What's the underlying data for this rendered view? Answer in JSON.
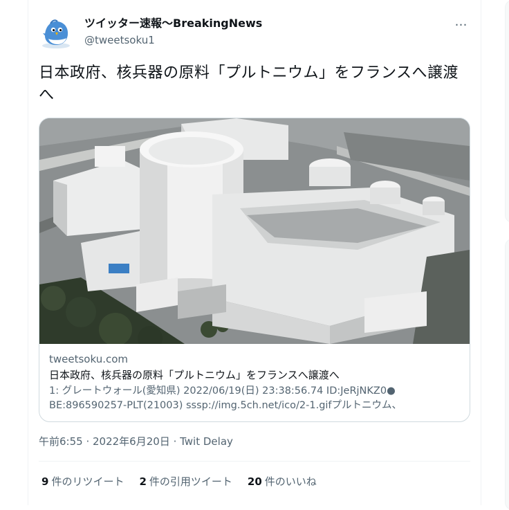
{
  "author": {
    "display_name": "ツイッター速報〜BreakingNews",
    "handle": "@tweetsoku1",
    "avatar_icon": "bird-avatar-icon"
  },
  "more_icon": "…",
  "tweet": {
    "text": "日本政府、核兵器の原料「プルトニウム」をフランスへ譲渡へ"
  },
  "card": {
    "domain": "tweetsoku.com",
    "title": "日本政府、核兵器の原料「プルトニウム」をフランスへ譲渡へ",
    "description_line1": "1: グレートウォール(愛知県) 2022/06/19(日) 23:38:56.74 ID:JeRjNKZ0●",
    "description_line2": "BE:896590257-PLT(21003) sssp://img.5ch.net/ico/2-1.gifプルトニウム、"
  },
  "meta": {
    "timestamp": "午前6:55 · 2022年6月20日",
    "separator": " · ",
    "source": "Twit Delay"
  },
  "stats": {
    "retweets_count": "9",
    "retweets_label": "件のリツイート",
    "quotes_count": "2",
    "quotes_label": "件の引用ツイート",
    "likes_count": "20",
    "likes_label": "件のいいね"
  },
  "colors": {
    "text_primary": "#0f1419",
    "text_secondary": "#536471",
    "border": "#cfd9de",
    "avatar_blue": "#4a8fd6"
  }
}
